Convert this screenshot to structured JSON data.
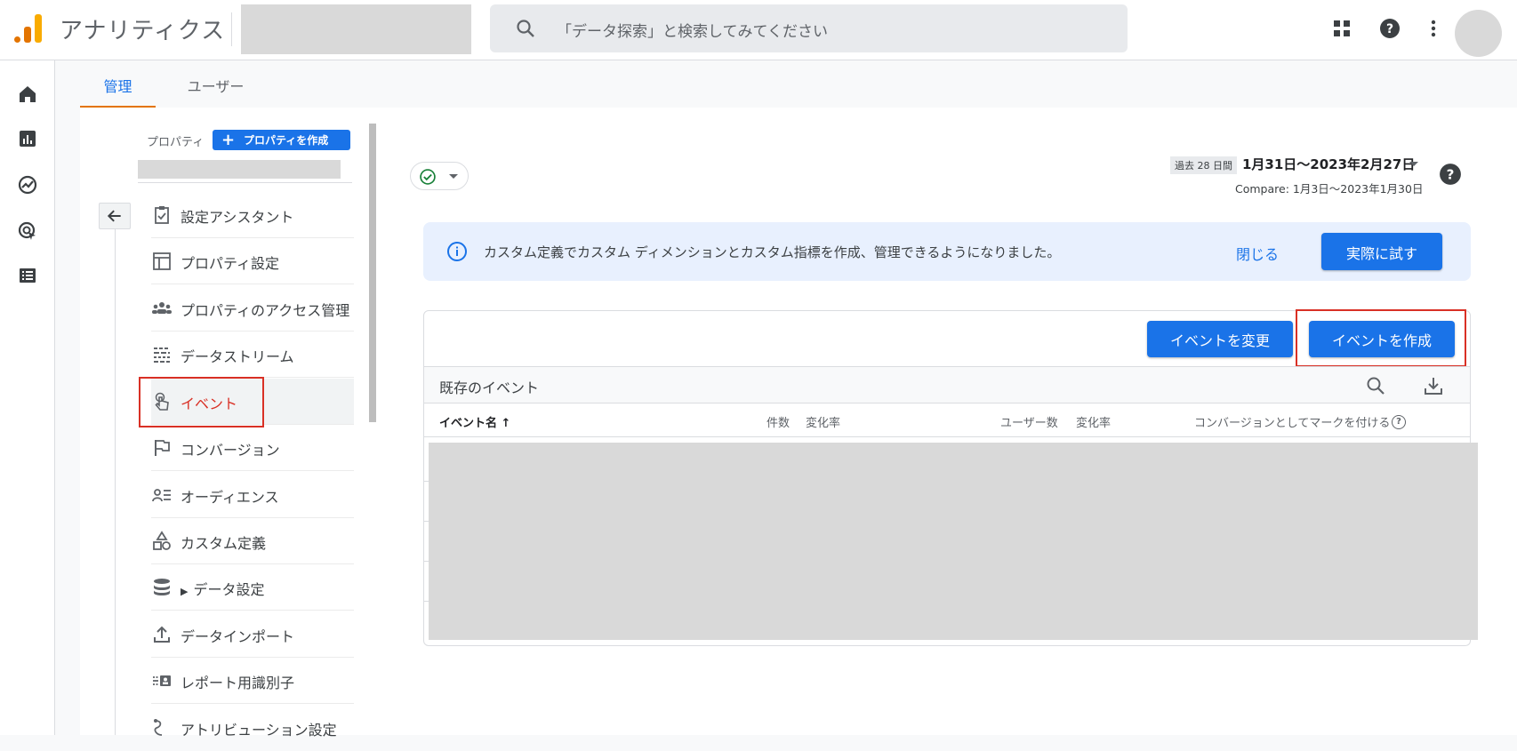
{
  "app": {
    "title": "アナリティクス"
  },
  "search": {
    "placeholder": "「データ探索」と検索してみてください"
  },
  "tabs": [
    {
      "label": "管理"
    },
    {
      "label": "ユーザー"
    }
  ],
  "nav": {
    "property_label": "プロパティ",
    "create_property": "プロパティを作成",
    "items": [
      {
        "label": "設定アシスタント",
        "icon": "clipboard-check-icon"
      },
      {
        "label": "プロパティ設定",
        "icon": "layout-icon"
      },
      {
        "label": "プロパティのアクセス管理",
        "icon": "people-icon"
      },
      {
        "label": "データストリーム",
        "icon": "streams-icon"
      },
      {
        "label": "イベント",
        "icon": "touch-icon",
        "active": true
      },
      {
        "label": "コンバージョン",
        "icon": "flag-icon"
      },
      {
        "label": "オーディエンス",
        "icon": "audience-icon"
      },
      {
        "label": "カスタム定義",
        "icon": "shapes-icon"
      },
      {
        "label": "データ設定",
        "icon": "database-icon"
      },
      {
        "label": "データインポート",
        "icon": "upload-icon"
      },
      {
        "label": "レポート用識別子",
        "icon": "identity-icon"
      },
      {
        "label": "アトリビューション設定",
        "icon": "attribution-icon"
      }
    ]
  },
  "date": {
    "chip": "過去 28 日間",
    "range": "1月31日～2023年2月27日",
    "compare": "Compare: 1月3日～2023年1月30日"
  },
  "banner": {
    "text": "カスタム定義でカスタム ディメンションとカスタム指標を作成、管理できるようになりました。",
    "close": "閉じる",
    "try": "実際に試す"
  },
  "events": {
    "modify_button": "イベントを変更",
    "create_button": "イベントを作成",
    "title": "既存のイベント",
    "columns": {
      "name": "イベント名 ↑",
      "count": "件数",
      "rate1": "変化率",
      "users": "ユーザー数",
      "rate2": "変化率",
      "conversion": "コンバージョンとしてマークを付ける",
      "help": "?"
    }
  },
  "colors": {
    "accent": "#1a73e8",
    "highlight": "#d93025",
    "brand_orange": "#e37400"
  }
}
